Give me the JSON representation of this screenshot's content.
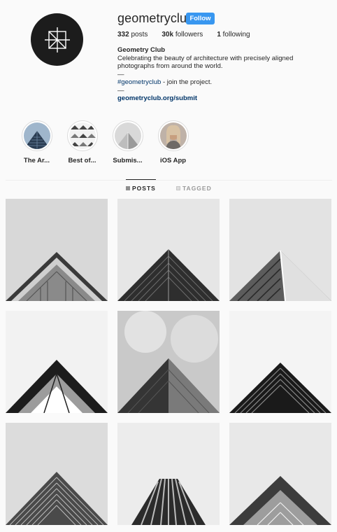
{
  "profile": {
    "username": "geometryclub",
    "follow_label": "Follow",
    "stats": {
      "posts_count": "332",
      "posts_label": "posts",
      "followers_count": "30k",
      "followers_label": "followers",
      "following_count": "1",
      "following_label": "following"
    },
    "bio": {
      "name": "Geometry Club",
      "line1": "Celebrating the beauty of architecture with precisely aligned",
      "line2": "photographs from around the world.",
      "sep1": "—",
      "hashtag": "#geometryclub",
      "hashtag_suffix": " - join the project.",
      "sep2": "—",
      "link": "geometryclub.org/submit"
    }
  },
  "highlights": [
    {
      "label": "The Ar..."
    },
    {
      "label": "Best of..."
    },
    {
      "label": "Submis..."
    },
    {
      "label": "iOS App"
    }
  ],
  "tabs": {
    "posts": "POSTS",
    "tagged": "TAGGED",
    "active": "posts"
  },
  "colors": {
    "follow_button": "#3897f0",
    "link": "#003569",
    "background": "#fafafa"
  }
}
